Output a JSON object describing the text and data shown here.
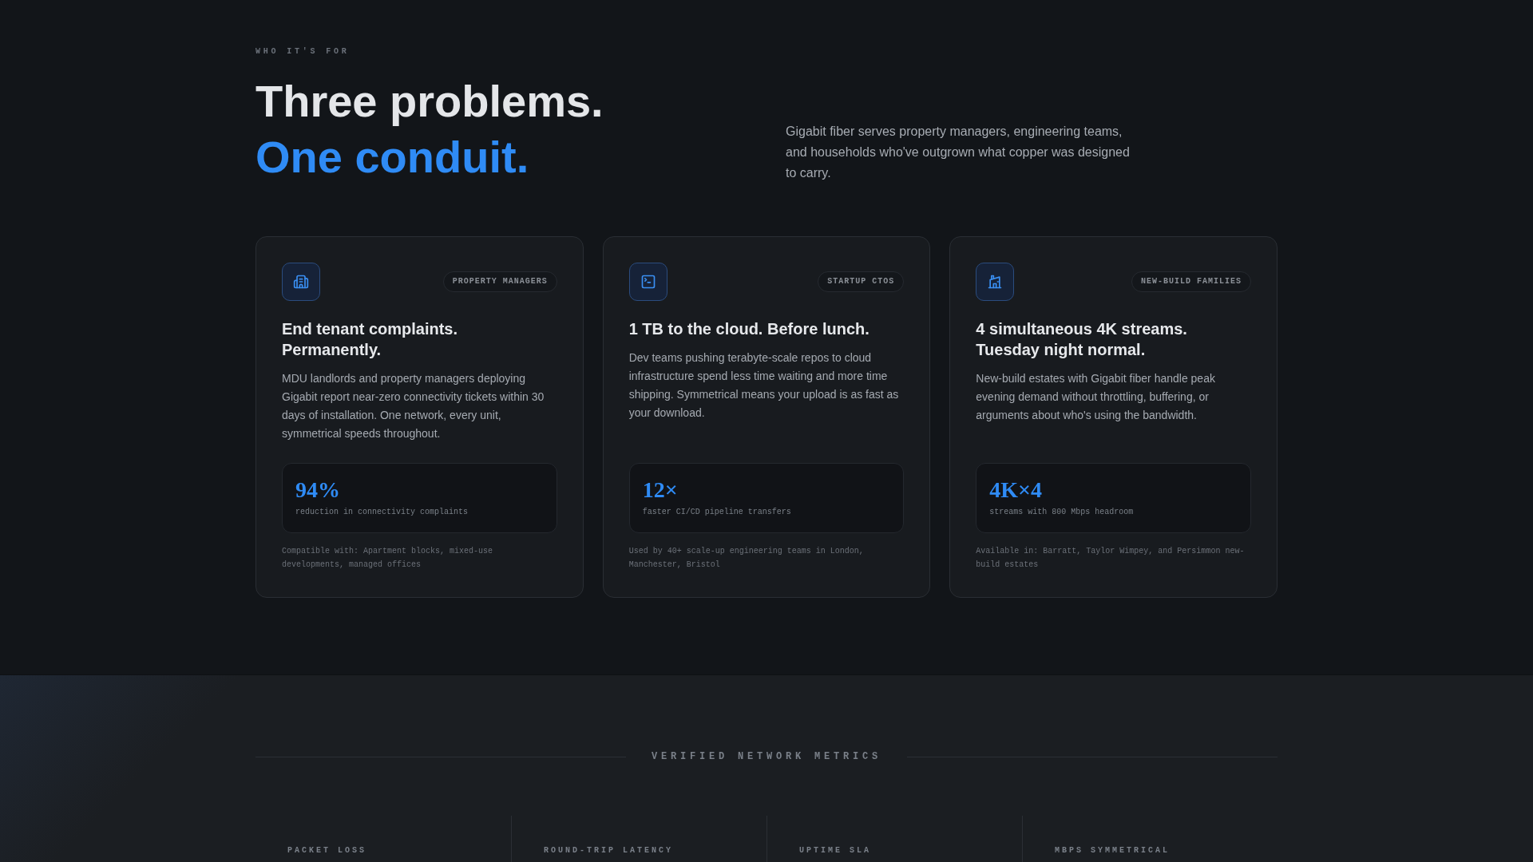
{
  "header": {
    "eyebrow": "WHO IT'S FOR",
    "headline": "Three problems.",
    "headline_accent": "One conduit.",
    "description": "Gigabit fiber serves property managers, engineering teams, and households who've outgrown what copper was designed to carry."
  },
  "cards": [
    {
      "tag": "PROPERTY MANAGERS",
      "title": "End tenant complaints. Permanently.",
      "body": "MDU landlords and property managers deploying Gigabit report near-zero connectivity tickets within 30 days of installation. One network, every unit, symmetrical speeds throughout.",
      "stat_value": "94%",
      "stat_label": "reduction in connectivity complaints",
      "footnote": "Compatible with: Apartment blocks, mixed-use developments, managed offices"
    },
    {
      "tag": "STARTUP CTOS",
      "title": "1 TB to the cloud. Before lunch.",
      "body": "Dev teams pushing terabyte-scale repos to cloud infrastructure spend less time waiting and more time shipping. Symmetrical means your upload is as fast as your download.",
      "stat_value": "12×",
      "stat_label": "faster CI/CD pipeline transfers",
      "footnote": "Used by 40+ scale-up engineering teams in London, Manchester, Bristol"
    },
    {
      "tag": "NEW-BUILD FAMILIES",
      "title": "4 simultaneous 4K streams. Tuesday night normal.",
      "body": "New-build estates with Gigabit fiber handle peak evening demand without throttling, buffering, or arguments about who's using the bandwidth.",
      "stat_value": "4K×4",
      "stat_label": "streams with 800 Mbps headroom",
      "footnote": "Available in: Barratt, Taylor Wimpey, and Persimmon new-build estates"
    }
  ],
  "metrics": {
    "title": "VERIFIED NETWORK METRICS",
    "labels": [
      "PACKET LOSS",
      "ROUND-TRIP LATENCY",
      "UPTIME SLA",
      "MBPS SYMMETRICAL"
    ]
  }
}
